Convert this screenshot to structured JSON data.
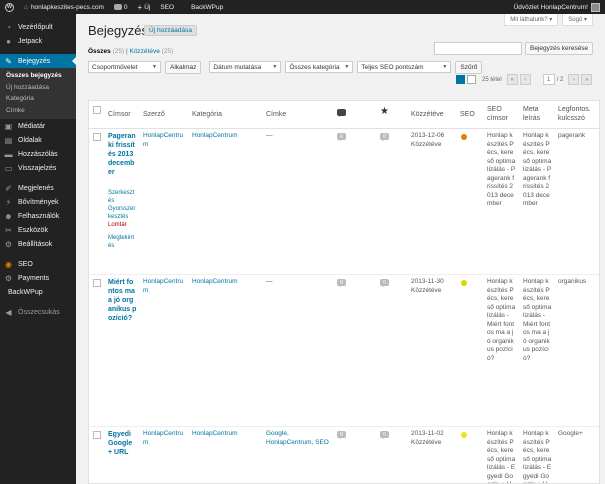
{
  "adminbar": {
    "site_name": "honlapkeszites-pecs.com",
    "comments_count": "0",
    "new_label": "Új",
    "seo_label": "SEO",
    "backwpup_label": "BackWPup",
    "greeting": "Üdvözlet HonlapCentrum!"
  },
  "sidebar": {
    "items": [
      {
        "label": "Vezérlőpult",
        "icon": "dashboard-icon"
      },
      {
        "label": "Jetpack",
        "icon": "jetpack-icon"
      },
      {
        "label": "Bejegyzés",
        "icon": "pin-icon"
      },
      {
        "label": "Médiatár",
        "icon": "media-icon"
      },
      {
        "label": "Oldalak",
        "icon": "pages-icon"
      },
      {
        "label": "Hozzászólás",
        "icon": "comments-icon"
      },
      {
        "label": "Visszajelzés",
        "icon": "feedback-icon"
      },
      {
        "label": "Megjelenés",
        "icon": "appearance-icon"
      },
      {
        "label": "Bővítmények",
        "icon": "plugins-icon"
      },
      {
        "label": "Felhasználók",
        "icon": "users-icon"
      },
      {
        "label": "Eszközök",
        "icon": "tools-icon"
      },
      {
        "label": "Beállítások",
        "icon": "settings-icon"
      },
      {
        "label": "SEO",
        "icon": "seo-icon"
      },
      {
        "label": "Payments",
        "icon": "payments-icon"
      },
      {
        "label": "BackWPup",
        "icon": "backwpup-icon"
      },
      {
        "label": "Összecsukás",
        "icon": "collapse-icon"
      }
    ],
    "submenu": [
      "Összes bejegyzés",
      "Új hozzáadása",
      "Kategória",
      "Címke"
    ]
  },
  "header": {
    "title": "Bejegyzés",
    "add_new": "Új hozzáadása",
    "screen_options": "Mit láthatunk?",
    "help": "Súgó"
  },
  "filters": {
    "all_label": "Összes",
    "all_count": "(25)",
    "separator": "|",
    "published_label": "Közzétéve",
    "published_count": "(25)",
    "search_button": "Bejegyzés keresése",
    "bulk_action": "Csoportművelet",
    "apply": "Alkalmaz",
    "date_filter": "Dátum mutatása",
    "category_filter": "Összes kategória",
    "seo_filter": "Teljes SEO pontszám",
    "filter_button": "Szűrő"
  },
  "pagination": {
    "items": "25 tétel",
    "first": "«",
    "prev": "‹",
    "current": "1",
    "of": "/ 2",
    "next": "›",
    "last": "»"
  },
  "columns": {
    "title": "Címsor",
    "author": "Szerző",
    "category": "Kategória",
    "tags": "Címke",
    "date": "Közzétéve",
    "seo": "SEO",
    "seo_title": "SEO címsor",
    "meta_desc": "Meta leírás",
    "focus_kw": "Legfontos. kulcsszó"
  },
  "colors": {
    "admin_bar": "#222222",
    "sidebar": "#222222",
    "accent": "#0074a2",
    "seo_orange": "#e07f00",
    "seo_yellow": "#d8d800",
    "seo_yellow_light": "#e6e61a"
  },
  "rows": [
    {
      "title": "Pageranki frissítés 2013 december",
      "actions": [
        "Szerkesztés",
        "Gyorsszerkesztés",
        "Lomtár",
        "Megtekintés"
      ],
      "author": "HonlapCentrum",
      "category": "HonlapCentrum",
      "tags": "—",
      "comments": "0",
      "date": "2013-12-06",
      "status": "Közzétéve",
      "seo_color": "#e07f00",
      "seo_title": "Honlap készítés Pécs, kereső optimalizálás - Pagerank frissítés 2013 december",
      "meta_desc": "Honlap készítés Pécs, kereső optimalizálás - Pagerank frissítés 2013 december",
      "focus_kw": "pagerank"
    },
    {
      "title": "Miért fontos ma a jó organikus pozíció?",
      "actions": [],
      "author": "HonlapCentrum",
      "category": "HonlapCentrum",
      "tags": "—",
      "comments": "0",
      "date": "2013-11-30",
      "status": "Közzétéve",
      "seo_color": "#d8d800",
      "seo_title": "Honlap készítés Pécs, kereső optimalizálás - Miért fontos ma a jó organikus pozíció?",
      "meta_desc": "Honlap készítés Pécs, kereső optimalizálás - Miért fontos ma a jó organikus pozíció?",
      "focus_kw": "organikus"
    },
    {
      "title": "Egyedi Google + URL",
      "actions": [],
      "author": "HonlapCentrum",
      "category": "HonlapCentrum",
      "tags": "Google, HonlapCentrum, SEO",
      "comments": "0",
      "date": "2013-11-02",
      "status": "Közzétéve",
      "seo_color": "#e6e61a",
      "seo_title": "Honlap készítés Pécs, kereső optimalizálás - Egyedi Google + URL",
      "meta_desc": "Honlap készítés Pécs, kereső optimalizálás - Egyedi Google + URL",
      "focus_kw": "Google+"
    }
  ]
}
